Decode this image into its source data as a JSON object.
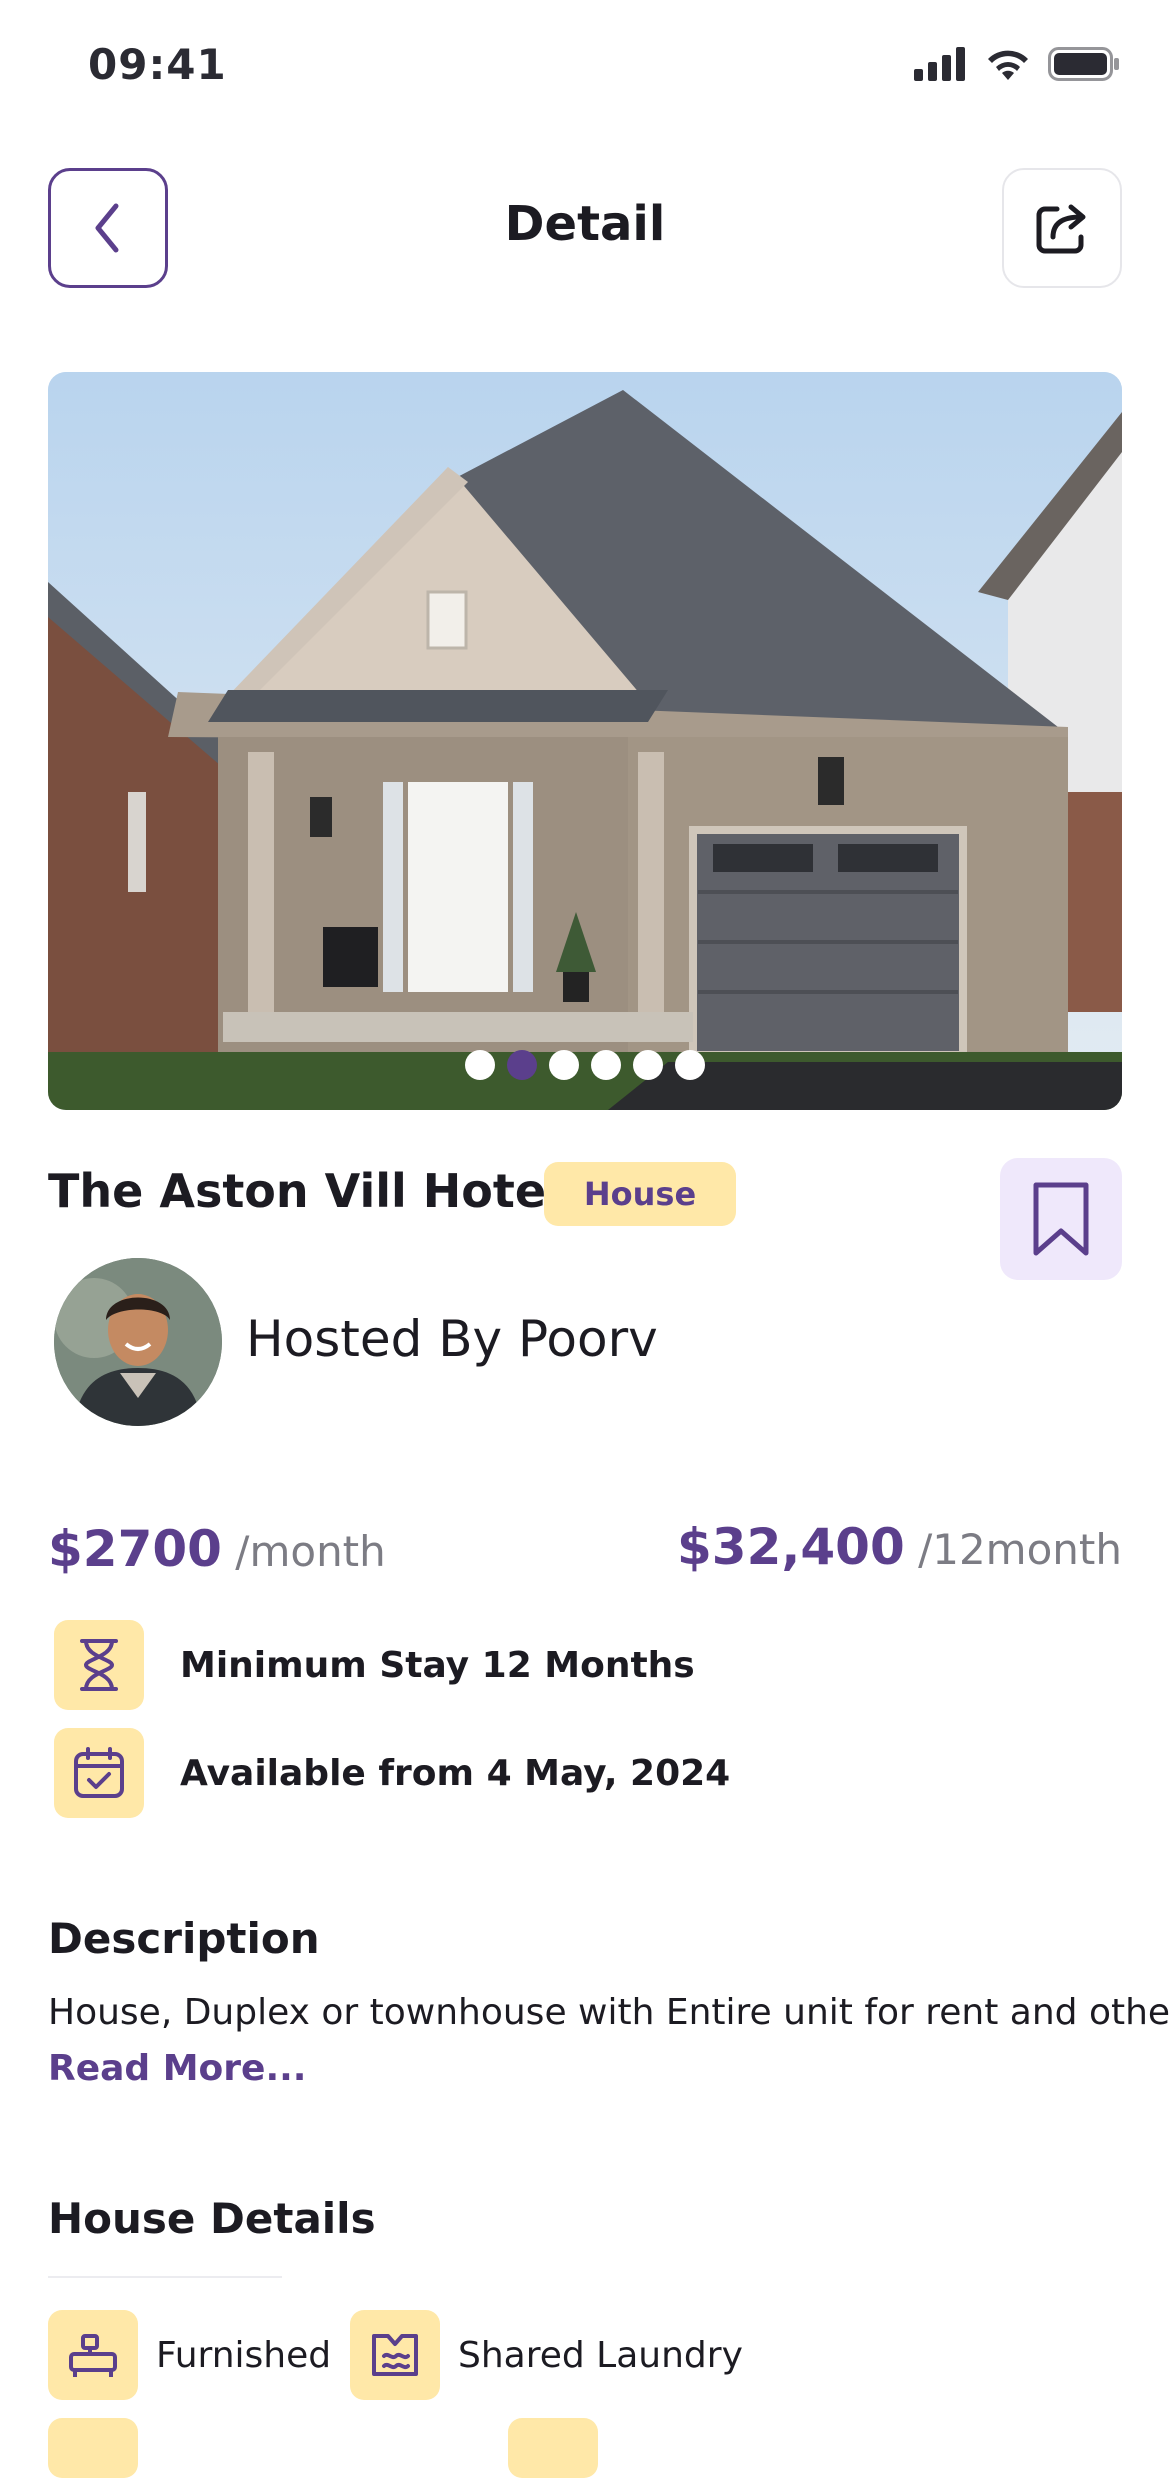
{
  "status_bar": {
    "time": "09:41",
    "icons": [
      "signal-icon",
      "wifi-icon",
      "battery-icon"
    ]
  },
  "header": {
    "title": "Detail",
    "back_icon": "chevron-left-icon",
    "share_icon": "share-icon"
  },
  "gallery": {
    "image": "house-photo",
    "slide_count": 6,
    "active_slide": 2
  },
  "listing": {
    "title": "The Aston Vill Hotel",
    "type_badge": "House",
    "bookmark_icon": "bookmark-icon"
  },
  "host": {
    "prefix": "Hosted By ",
    "name": "Poorv"
  },
  "pricing": {
    "monthly_price": "$2700",
    "monthly_unit": " /month",
    "yearly_price": "$32,400",
    "yearly_unit": " /12month"
  },
  "info": [
    {
      "icon": "hourglass-icon",
      "text": "Minimum Stay 12 Months"
    },
    {
      "icon": "calendar-check-icon",
      "text": "Available from 4 May, 2024"
    }
  ],
  "description": {
    "heading": "Description",
    "text": "House, Duplex or townhouse with Entire unit for rent and other",
    "read_more": "Read More..."
  },
  "house_details": {
    "heading": "House Details",
    "items": [
      {
        "icon": "furniture-icon",
        "label": "Furnished"
      },
      {
        "icon": "laundry-icon",
        "label": "Shared Laundry"
      }
    ]
  },
  "colors": {
    "accent": "#5b3f8c",
    "badge_bg": "#ffe8a8",
    "bookmark_bg": "#efe8fb"
  }
}
